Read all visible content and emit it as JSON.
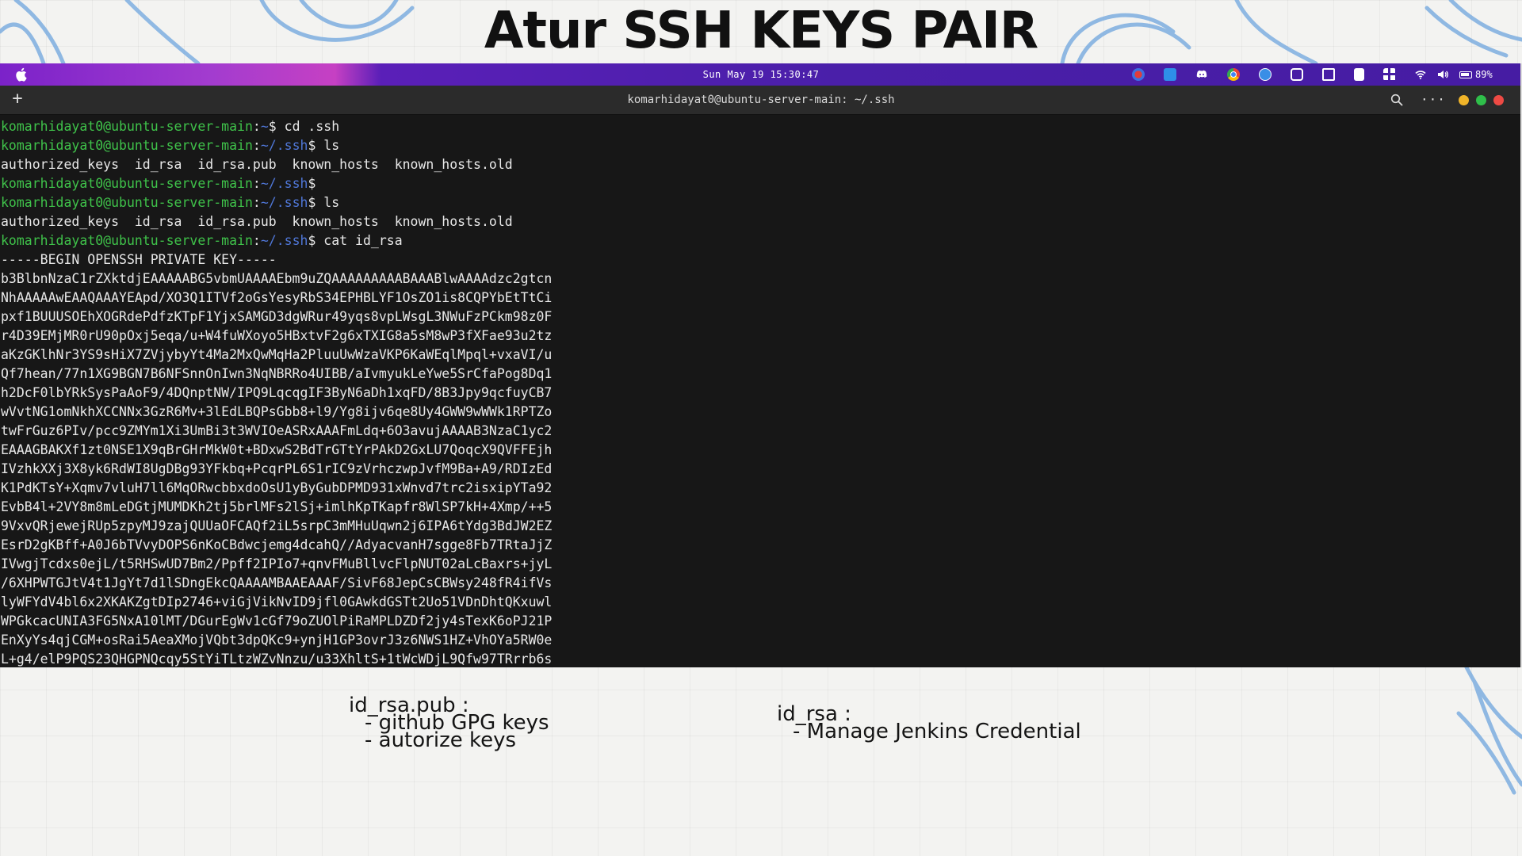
{
  "slide": {
    "title": "Atur SSH KEYS PAIR"
  },
  "menubar": {
    "datetime": "Sun May 19 15:30:47",
    "battery": "89%"
  },
  "terminal": {
    "window_title": "komarhidayat0@ubuntu-server-main: ~/.ssh",
    "lines": [
      {
        "user": "komarhidayat0@ubuntu-server-main",
        "sep": ":",
        "path": "~",
        "cmd": "$ cd .ssh"
      },
      {
        "user": "komarhidayat0@ubuntu-server-main",
        "sep": ":",
        "path": "~/.ssh",
        "cmd": "$ ls"
      },
      {
        "text": "authorized_keys  id_rsa  id_rsa.pub  known_hosts  known_hosts.old"
      },
      {
        "user": "komarhidayat0@ubuntu-server-main",
        "sep": ":",
        "path": "~/.ssh",
        "cmd": "$"
      },
      {
        "user": "komarhidayat0@ubuntu-server-main",
        "sep": ":",
        "path": "~/.ssh",
        "cmd": "$ ls"
      },
      {
        "text": "authorized_keys  id_rsa  id_rsa.pub  known_hosts  known_hosts.old"
      },
      {
        "user": "komarhidayat0@ubuntu-server-main",
        "sep": ":",
        "path": "~/.ssh",
        "cmd": "$ cat id_rsa"
      },
      {
        "text": "-----BEGIN OPENSSH PRIVATE KEY-----"
      },
      {
        "text": "b3BlbnNzaC1rZXktdjEAAAAABG5vbmUAAAAEbm9uZQAAAAAAAAABAAABlwAAAAdzc2gtcn"
      },
      {
        "text": "NhAAAAAwEAAQAAAYEApd/XO3Q1ITVf2oGsYesyRbS34EPHBLYF1OsZO1is8CQPYbEtTtCi"
      },
      {
        "text": "pxf1BUUUSOEhXOGRdePdfzKTpF1YjxSAMGD3dgWRur49yqs8vpLWsgL3NWuFzPCkm98z0F"
      },
      {
        "text": "r4D39EMjMR0rU90pOxj5eqa/u+W4fuWXoyo5HBxtvF2g6xTXIG8a5sM8wP3fXFae93u2tz"
      },
      {
        "text": "aKzGKlhNr3YS9sHiX7ZVjybyYt4Ma2MxQwMqHa2PluuUwWzaVKP6KaWEqlMpql+vxaVI/u"
      },
      {
        "text": "Qf7hean/77n1XG9BGN7B6NFSnnOnIwn3NqNBRRo4UIBB/aIvmyukLeYwe5SrCfaPog8Dq1"
      },
      {
        "text": "h2DcF0lbYRkSysPaAoF9/4DQnptNW/IPQ9LqcqgIF3ByN6aDh1xqFD/8B3Jpy9qcfuyCB7"
      },
      {
        "text": "wVvtNG1omNkhXCCNNx3GzR6Mv+3lEdLBQPsGbb8+l9/Yg8ijv6qe8Uy4GWW9wWWk1RPTZo"
      },
      {
        "text": "twFrGuz6PIv/pcc9ZMYm1Xi3UmBi3t3WVIOeASRxAAAFmLdq+6O3avujAAAAB3NzaC1yc2"
      },
      {
        "text": "EAAAGBAKXf1zt0NSE1X9qBrGHrMkW0t+BDxwS2BdTrGTtYrPAkD2GxLU7QoqcX9QVFFEjh"
      },
      {
        "text": "IVzhkXXj3X8yk6RdWI8UgDBg93YFkbq+PcqrPL6S1rIC9zVrhczwpJvfM9Ba+A9/RDIzEd"
      },
      {
        "text": "K1PdKTsY+Xqmv7vluH7ll6MqORwcbbxdoOsU1yByGubDPMD931xWnvd7trc2isxipYTa92"
      },
      {
        "text": "EvbB4l+2VY8m8mLeDGtjMUMDKh2tj5brlMFs2lSj+imlhKpTKapfr8WlSP7kH+4Xmp/++5"
      },
      {
        "text": "9VxvQRjewejRUp5zpyMJ9zajQUUaOFCAQf2iL5srpC3mMHuUqwn2j6IPA6tYdg3BdJW2EZ"
      },
      {
        "text": "EsrD2gKBff+A0J6bTVvyDOPS6nKoCBdwcjemg4dcahQ//AdyacvanH7sgge8Fb7TRtaJjZ"
      },
      {
        "text": "IVwgjTcdxs0ejL/t5RHSwUD7Bm2/Ppff2IPIo7+qnvFMuBllvcFlpNUT02aLcBaxrs+jyL"
      },
      {
        "text": "/6XHPWTGJtV4t1JgYt7d1lSDngEkcQAAAAMBAAEAAAF/SivF68JepCsCBWsy248fR4ifVs"
      },
      {
        "text": "lyWFYdV4bl6x2XKAKZgtDIp2746+viGjVikNvID9jfl0GAwkdGSTt2Uo51VDnDhtQKxuwl"
      },
      {
        "text": "WPGkcacUNIA3FG5NxA10lMT/DGurEgWv1cGf79oZUOlPiRaMPLDZDf2jy4sTexK6oPJ21P"
      },
      {
        "text": "EnXyYs4qjCGM+osRai5AeaXMojVQbt3dpQKc9+ynjH1GP3ovrJ3z6NWS1HZ+VhOYa5RW0e"
      },
      {
        "text": "L+g4/elP9PQS23QHGPNQcqy5StYiTLtzWZvNnzu/u33XhltS+1tWcWDjL9Qfw97TRrrb6s"
      }
    ]
  },
  "notes": {
    "left": {
      "heading": "id_rsa.pub :",
      "items": [
        "- github GPG keys",
        "- autorize keys"
      ]
    },
    "right": {
      "heading": "id_rsa :",
      "items": [
        "- Manage Jenkins Credential"
      ]
    }
  },
  "colors": {
    "prompt_user": "#3fc24a",
    "prompt_path": "#4f76d6",
    "terminal_bg": "#171717",
    "menubar_accent": "#461ca3"
  }
}
